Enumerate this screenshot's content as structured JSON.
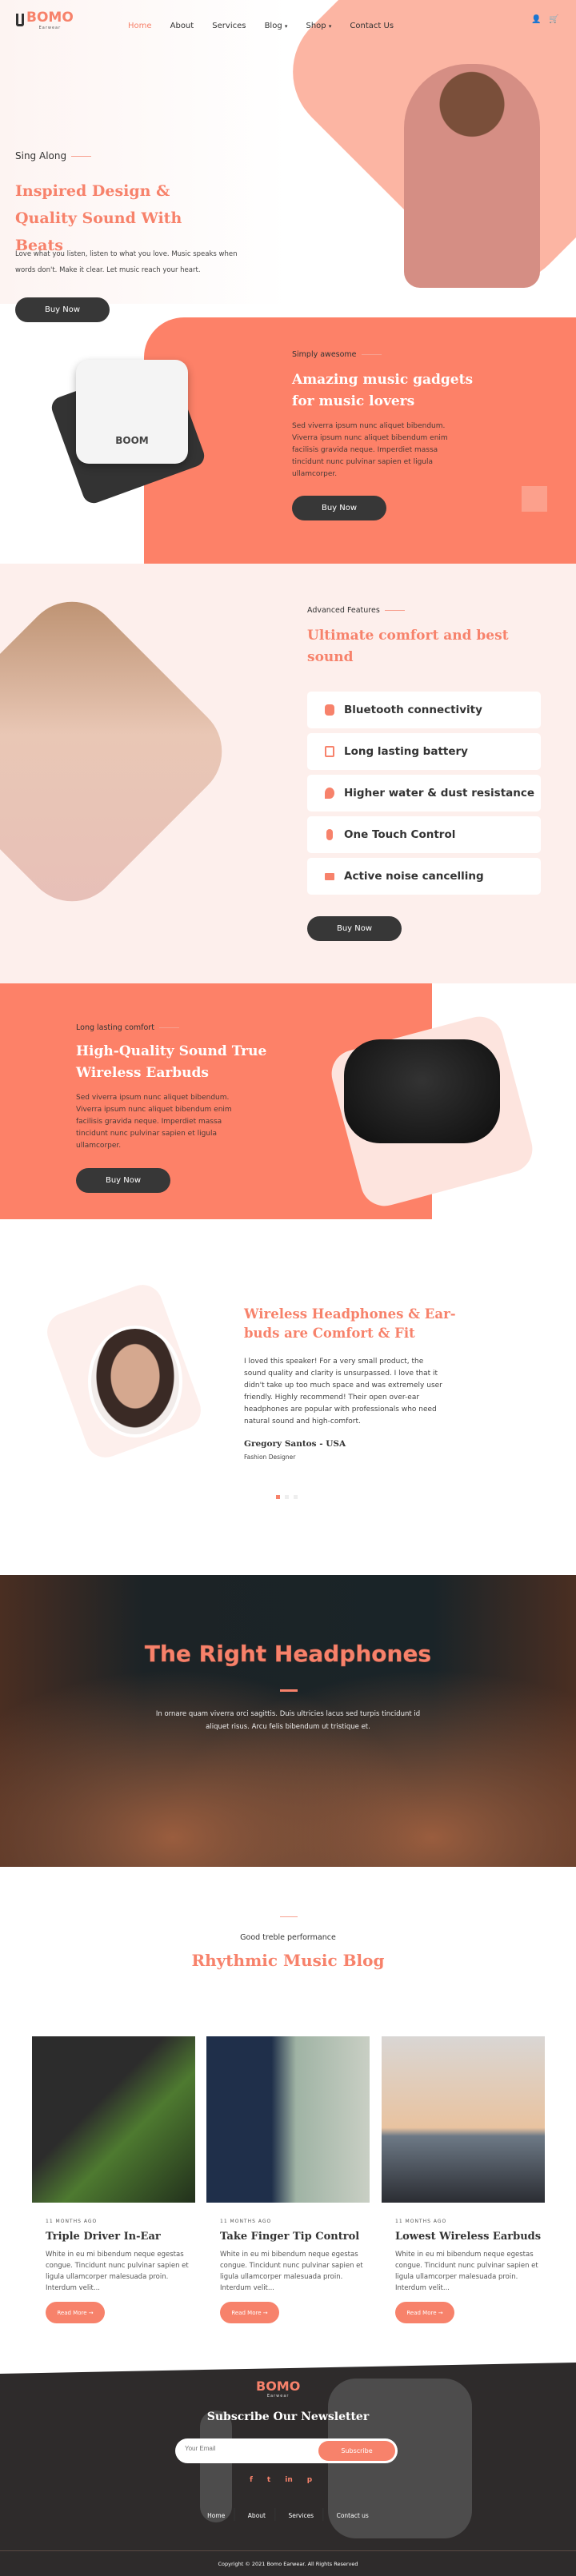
{
  "brand": {
    "name": "BOMO",
    "tagline": "Earwear"
  },
  "nav": {
    "items": [
      "Home",
      "About",
      "Services",
      "Blog",
      "Shop",
      "Contact Us"
    ],
    "active": "Home"
  },
  "colors": {
    "accent": "#f7826b",
    "dark": "#373737",
    "light_pink": "#fdefec"
  },
  "hero": {
    "eyebrow": "Sing Along",
    "title": "Inspired Design & Quality Sound With Beats",
    "text": "Love what you listen, listen to what you love. Music speaks when words don't. Make it clear. Let music reach your heart.",
    "button": "Buy Now"
  },
  "gadgets": {
    "case_label": "BOOM",
    "eyebrow": "Simply awesome",
    "title": "Amazing music gadgets for music lovers",
    "text": "Sed viverra ipsum nunc aliquet bibendum. Viverra ipsum nunc aliquet bibendum enim facilisis gravida neque. Imperdiet massa tincidunt nunc pulvinar sapien et ligula ullamcorper.",
    "button": "Buy Now"
  },
  "features": {
    "eyebrow": "Advanced Features",
    "title": "Ultimate comfort and best sound",
    "items": [
      {
        "label": "Bluetooth connectivity",
        "icon": "bluetooth-icon"
      },
      {
        "label": "Long lasting battery",
        "icon": "battery-icon"
      },
      {
        "label": "Higher water & dust resistance",
        "icon": "water-drop-icon"
      },
      {
        "label": "One Touch Control",
        "icon": "microphone-icon"
      },
      {
        "label": "Active noise cancelling",
        "icon": "speaker-icon"
      }
    ],
    "button": "Buy Now"
  },
  "earbuds": {
    "eyebrow": "Long lasting comfort",
    "title": "High-Quality Sound True Wireless Earbuds",
    "text": "Sed viverra ipsum nunc aliquet bibendum. Viverra ipsum nunc aliquet bibendum enim facilisis gravida neque. Imperdiet massa tincidunt nunc pulvinar sapien et ligula ullamcorper.",
    "button": "Buy Now"
  },
  "testimonial": {
    "title": "Wireless Headphones & Ear-buds are Comfort & Fit",
    "quote": "I loved this speaker! For a very small product, the sound quality and clarity is unsurpassed. I love that it didn't take up too much space and was extremely user friendly. Highly recommend! Their open over-ear headphones are popular with professionals who need natural sound and high-comfort.",
    "name": "Gregory Santos - USA",
    "role": "Fashion Designer",
    "slides": 3,
    "active_slide": 1
  },
  "banner": {
    "title": "The Right Headphones",
    "text": "In ornare quam viverra orci sagittis. Duis ultricies lacus sed turpis tincidunt id aliquet risus. Arcu felis bibendum ut tristique et."
  },
  "blog": {
    "eyebrow": "Good treble performance",
    "title": "Rhythmic Music Blog",
    "posts": [
      {
        "date": "11 MONTHS AGO",
        "title": "Triple Driver In-Ear",
        "excerpt": "White in eu mi bibendum neque egestas congue. Tincidunt nunc pulvinar sapien et ligula ullamcorper malesuada proin. Interdum velit...",
        "button": "Read More"
      },
      {
        "date": "11 MONTHS AGO",
        "title": "Take Finger Tip Control",
        "excerpt": "White in eu mi bibendum neque egestas congue. Tincidunt nunc pulvinar sapien et ligula ullamcorper malesuada proin. Interdum velit...",
        "button": "Read More"
      },
      {
        "date": "11 MONTHS AGO",
        "title": "Lowest Wireless Earbuds",
        "excerpt": "White in eu mi bibendum neque egestas congue. Tincidunt nunc pulvinar sapien et ligula ullamcorper malesuada proin. Interdum velit...",
        "button": "Read More"
      }
    ]
  },
  "footer": {
    "title": "Subscribe Our Newsletter",
    "email_placeholder": "Your Email",
    "subscribe": "Subscribe",
    "social": [
      "f",
      "t",
      "in",
      "p"
    ],
    "links": [
      "Home",
      "About",
      "Services",
      "Contact us"
    ],
    "copyright": "Copyright © 2021 Bomo Earwear. All Rights Reserved"
  }
}
